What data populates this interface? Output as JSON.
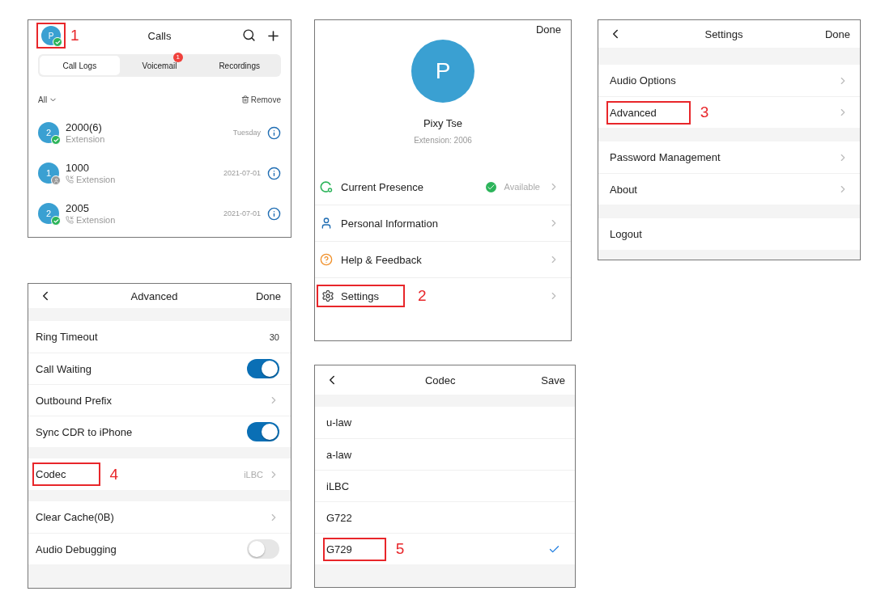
{
  "calls": {
    "title": "Calls",
    "avatar": {
      "initial": "P",
      "online": true,
      "annotation": "1"
    },
    "tabs": [
      {
        "label": "Call Logs",
        "selected": true
      },
      {
        "label": "Voicemail",
        "selected": false,
        "badge": "1"
      },
      {
        "label": "Recordings",
        "selected": false
      }
    ],
    "filter": "All",
    "remove": "Remove",
    "logs": [
      {
        "initial": "2",
        "online": true,
        "name": "2000(6)",
        "sub": "Extension",
        "call_icon": false,
        "date": "Tuesday"
      },
      {
        "initial": "1",
        "online": false,
        "name": "1000",
        "sub": "Extension",
        "call_icon": true,
        "date": "2021-07-01"
      },
      {
        "initial": "2",
        "online": true,
        "name": "2005",
        "sub": "Extension",
        "call_icon": true,
        "date": "2021-07-01"
      }
    ]
  },
  "profile": {
    "done": "Done",
    "initial": "P",
    "name": "Pixy Tse",
    "extension": "Extension: 2006",
    "items": [
      {
        "label": "Current Presence",
        "value": "Available"
      },
      {
        "label": "Personal Information"
      },
      {
        "label": "Help & Feedback"
      },
      {
        "label": "Settings",
        "annotation": "2"
      }
    ]
  },
  "settings": {
    "title": "Settings",
    "done": "Done",
    "groups": [
      [
        {
          "label": "Audio Options",
          "chevron": true
        },
        {
          "label": "Advanced",
          "chevron": true,
          "annotation": "3"
        }
      ],
      [
        {
          "label": "Password Management",
          "chevron": true
        },
        {
          "label": "About",
          "chevron": true
        }
      ],
      [
        {
          "label": "Logout",
          "chevron": false
        }
      ]
    ]
  },
  "advanced": {
    "title": "Advanced",
    "done": "Done",
    "groups": [
      [
        {
          "kind": "value",
          "label": "Ring Timeout",
          "value": "30"
        },
        {
          "kind": "toggle",
          "label": "Call Waiting",
          "on": true
        },
        {
          "kind": "link",
          "label": "Outbound Prefix"
        },
        {
          "kind": "toggle",
          "label": "Sync CDR to iPhone",
          "on": true
        }
      ],
      [
        {
          "kind": "link",
          "label": "Codec",
          "value": "iLBC",
          "annotation": "4"
        }
      ],
      [
        {
          "kind": "link",
          "label": "Clear Cache(0B)"
        },
        {
          "kind": "toggle",
          "label": "Audio Debugging",
          "on": false
        }
      ]
    ]
  },
  "codec": {
    "title": "Codec",
    "save": "Save",
    "items": [
      {
        "label": "u-law",
        "selected": false
      },
      {
        "label": "a-law",
        "selected": false
      },
      {
        "label": "iLBC",
        "selected": false
      },
      {
        "label": "G722",
        "selected": false
      },
      {
        "label": "G729",
        "selected": true,
        "annotation": "5"
      }
    ]
  }
}
